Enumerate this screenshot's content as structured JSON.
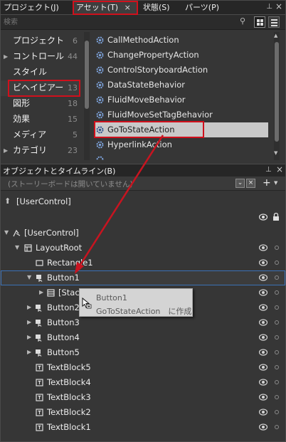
{
  "tabs": [
    {
      "label": "プロジェクト(J)"
    },
    {
      "label": "アセット(T)",
      "close": "×"
    },
    {
      "label": "状態(S)"
    },
    {
      "label": "パーツ(P)"
    }
  ],
  "search": {
    "placeholder": "検索"
  },
  "categories": [
    {
      "label": "プロジェクト",
      "count": "6"
    },
    {
      "label": "コントロール",
      "count": "44"
    },
    {
      "label": "スタイル",
      "count": ""
    },
    {
      "label": "ビヘイビアー",
      "count": "13"
    },
    {
      "label": "図形",
      "count": "18"
    },
    {
      "label": "効果",
      "count": "15"
    },
    {
      "label": "メディア",
      "count": "5"
    },
    {
      "label": "カテゴリ",
      "count": "23"
    }
  ],
  "behaviors": [
    "CallMethodAction",
    "ChangePropertyAction",
    "ControlStoryboardAction",
    "DataStateBehavior",
    "FluidMoveBehavior",
    "FluidMoveSetTagBehavior",
    "GoToStateAction",
    "HyperlinkAction"
  ],
  "objects_panel": {
    "title": "オブジェクトとタイムライン(B)",
    "storyboard": "(ストーリーボードは開いていません)",
    "scope_label": "[UserControl]"
  },
  "tree": [
    {
      "label": "[UserControl]"
    },
    {
      "label": "LayoutRoot"
    },
    {
      "label": "Rectangle1"
    },
    {
      "label": "Button1"
    },
    {
      "label": "[StackPanel]"
    },
    {
      "label": "Button2"
    },
    {
      "label": "Button3"
    },
    {
      "label": "Button4"
    },
    {
      "label": "Button5"
    },
    {
      "label": "TextBlock5"
    },
    {
      "label": "TextBlock4"
    },
    {
      "label": "TextBlock3"
    },
    {
      "label": "TextBlock2"
    },
    {
      "label": "TextBlock1"
    }
  ],
  "tooltip": {
    "line1": "Button1",
    "line2": "GoToStateAction　に作成"
  },
  "colors": {
    "highlight": "#d0101c",
    "selection_border": "#3b71b6"
  }
}
